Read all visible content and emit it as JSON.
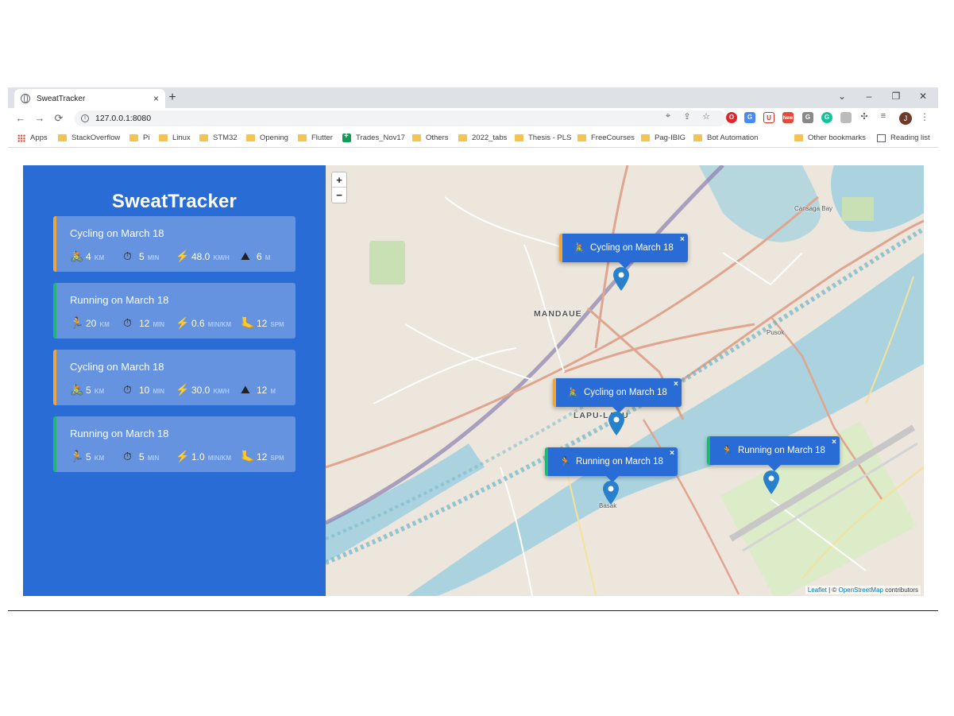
{
  "browser": {
    "tab_title": "SweatTracker",
    "tab_close": "×",
    "new_tab": "+",
    "url": "127.0.0.1:8080",
    "window_controls": [
      "⌄",
      "–",
      "❐",
      "✕"
    ],
    "profile_initial": "J",
    "extension_badge": "New"
  },
  "bookmarks": {
    "apps": "Apps",
    "items": [
      "StackOverflow",
      "Pi",
      "Linux",
      "STM32",
      "Opening",
      "Flutter",
      "Trades_Nov17",
      "Others",
      "2022_tabs",
      "Thesis - PLS",
      "FreeCourses",
      "Pag-IBIG",
      "Bot Automation"
    ],
    "other": "Other bookmarks",
    "reading_list": "Reading list"
  },
  "app": {
    "title": "SweatTracker"
  },
  "workouts": [
    {
      "type": "cycling",
      "title": "Cycling on March 18",
      "type_icon": "🚴",
      "distance": "4",
      "distance_unit": "km",
      "duration": "5",
      "duration_unit": "min",
      "speed": "48.0",
      "speed_unit": "km/h",
      "extra_icon": "⛰",
      "extra": "6",
      "extra_unit": "m"
    },
    {
      "type": "running",
      "title": "Running on March 18",
      "type_icon": "🏃",
      "distance": "20",
      "distance_unit": "km",
      "duration": "12",
      "duration_unit": "min",
      "speed": "0.6",
      "speed_unit": "min/km",
      "extra_icon": "🦶",
      "extra": "12",
      "extra_unit": "spm"
    },
    {
      "type": "cycling",
      "title": "Cycling on March 18",
      "type_icon": "🚴",
      "distance": "5",
      "distance_unit": "km",
      "duration": "10",
      "duration_unit": "min",
      "speed": "30.0",
      "speed_unit": "km/h",
      "extra_icon": "⛰",
      "extra": "12",
      "extra_unit": "m"
    },
    {
      "type": "running",
      "title": "Running on March 18",
      "type_icon": "🏃",
      "distance": "5",
      "distance_unit": "km",
      "duration": "5",
      "duration_unit": "min",
      "speed": "1.0",
      "speed_unit": "min/km",
      "extra_icon": "🦶",
      "extra": "12",
      "extra_unit": "spm"
    }
  ],
  "icons": {
    "duration": "⏱",
    "speed": "⚡"
  },
  "map": {
    "zoom_in": "+",
    "zoom_out": "−",
    "labels": {
      "mandaue": "MANDAUE",
      "lapulapu": "LAPU-LAPU",
      "basak": "Basak",
      "pusok": "Pusok",
      "cansaga": "Cansaga Bay"
    },
    "popups": [
      {
        "type": "cycling",
        "icon": "🚴",
        "label": "Cycling on March 18"
      },
      {
        "type": "cycling",
        "icon": "🚴",
        "label": "Cycling on March 18"
      },
      {
        "type": "running",
        "icon": "🏃",
        "label": "Running on March 18"
      },
      {
        "type": "running",
        "icon": "🏃",
        "label": "Running on March 18"
      }
    ],
    "popup_close": "×",
    "attribution_leaflet": "Leaflet",
    "attribution_sep": " | © ",
    "attribution_osm": "OpenStreetMap",
    "attribution_tail": " contributors",
    "marker_color": "#2a81cb"
  }
}
